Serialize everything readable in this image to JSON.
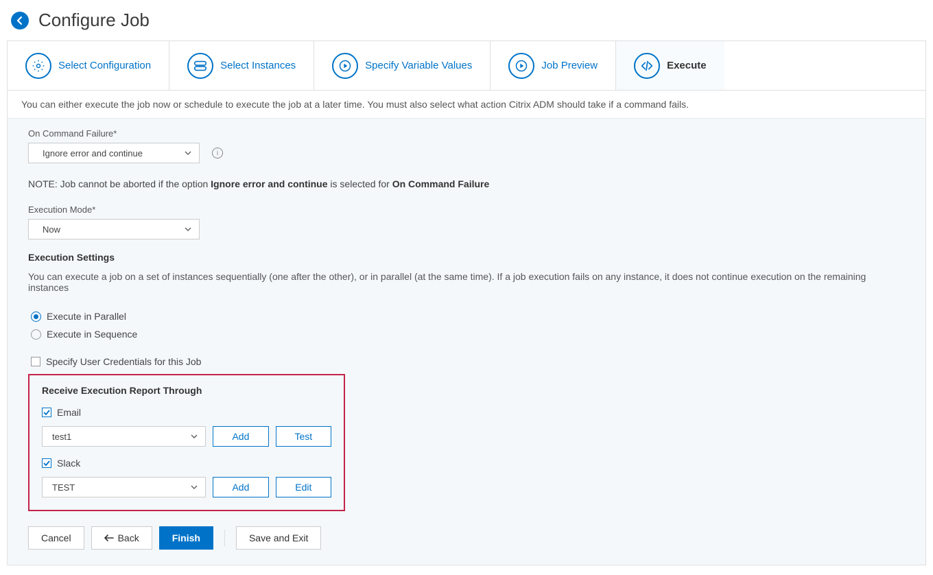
{
  "header": {
    "title": "Configure Job"
  },
  "tabs": {
    "items": [
      {
        "label": "Select Configuration"
      },
      {
        "label": "Select Instances"
      },
      {
        "label": "Specify Variable Values"
      },
      {
        "label": "Job Preview"
      },
      {
        "label": "Execute"
      }
    ],
    "active": 4
  },
  "infobar": "You can either execute the job now or schedule to execute the job at a later time. You must also select what action Citrix ADM should take if a command fails.",
  "commandFailure": {
    "label": "On Command Failure*",
    "value": "Ignore error and continue"
  },
  "note": {
    "prefix": "NOTE: Job cannot be aborted if the option ",
    "bold1": "Ignore error and continue",
    "middle": " is selected for ",
    "bold2": "On Command Failure"
  },
  "executionMode": {
    "label": "Execution Mode*",
    "value": "Now"
  },
  "execSettings": {
    "heading": "Execution Settings",
    "desc": "You can execute a job on a set of instances sequentially (one after the other), or in parallel (at the same time). If a job execution fails on any instance, it does not continue execution on the remaining instances",
    "options": {
      "parallel": "Execute in Parallel",
      "sequence": "Execute in Sequence"
    },
    "specifyCred": "Specify User Credentials for this Job"
  },
  "report": {
    "heading": "Receive Execution Report Through",
    "email": {
      "label": "Email",
      "value": "test1",
      "add": "Add",
      "test": "Test"
    },
    "slack": {
      "label": "Slack",
      "value": "TEST",
      "add": "Add",
      "edit": "Edit"
    }
  },
  "footer": {
    "cancel": "Cancel",
    "back": "Back",
    "finish": "Finish",
    "saveExit": "Save and Exit"
  }
}
